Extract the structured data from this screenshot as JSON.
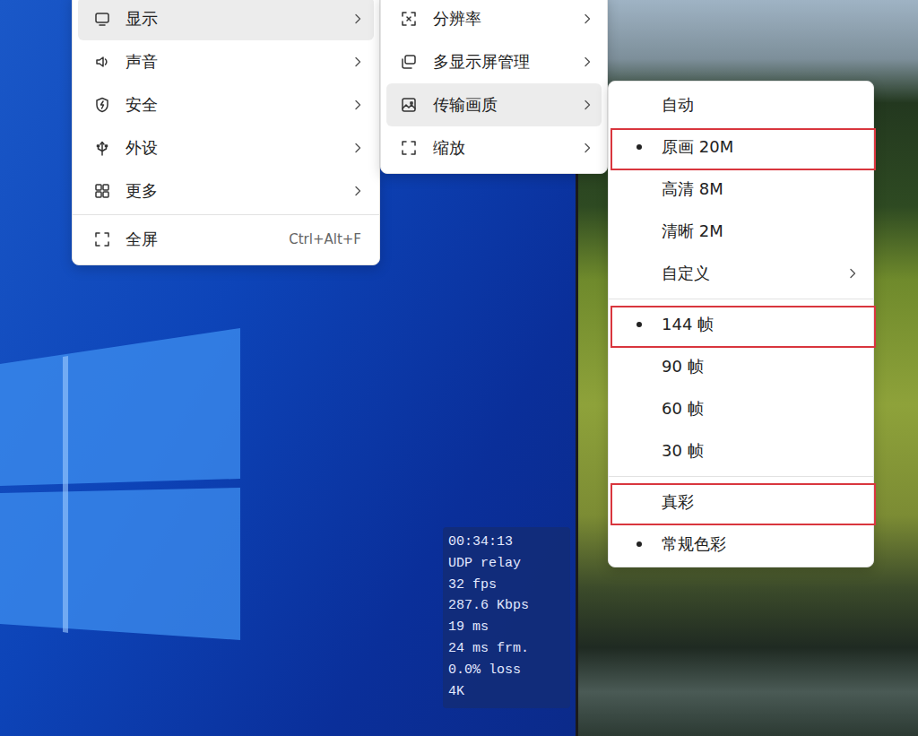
{
  "main_menu": {
    "items": [
      {
        "label": "显示",
        "has_submenu": true,
        "active": true
      },
      {
        "label": "声音",
        "has_submenu": true,
        "active": false
      },
      {
        "label": "安全",
        "has_submenu": true,
        "active": false
      },
      {
        "label": "外设",
        "has_submenu": true,
        "active": false
      },
      {
        "label": "更多",
        "has_submenu": true,
        "active": false
      }
    ],
    "footer_item": {
      "label": "全屏",
      "shortcut": "Ctrl+Alt+F"
    }
  },
  "display_menu": {
    "items": [
      {
        "label": "分辨率",
        "has_submenu": true,
        "active": false
      },
      {
        "label": "多显示屏管理",
        "has_submenu": true,
        "active": false
      },
      {
        "label": "传输画质",
        "has_submenu": true,
        "active": true
      },
      {
        "label": "缩放",
        "has_submenu": true,
        "active": false
      }
    ]
  },
  "quality_menu": {
    "groups": [
      {
        "items": [
          {
            "label": "自动",
            "selected": false,
            "has_submenu": false,
            "marked": false
          },
          {
            "label": "原画 20M",
            "selected": true,
            "has_submenu": false,
            "marked": true
          },
          {
            "label": "高清 8M",
            "selected": false,
            "has_submenu": false,
            "marked": false
          },
          {
            "label": "清晰 2M",
            "selected": false,
            "has_submenu": false,
            "marked": false
          },
          {
            "label": "自定义",
            "selected": false,
            "has_submenu": true,
            "marked": false
          }
        ]
      },
      {
        "items": [
          {
            "label": "144 帧",
            "selected": true,
            "has_submenu": false,
            "marked": true
          },
          {
            "label": "90 帧",
            "selected": false,
            "has_submenu": false,
            "marked": false
          },
          {
            "label": "60 帧",
            "selected": false,
            "has_submenu": false,
            "marked": false
          },
          {
            "label": "30 帧",
            "selected": false,
            "has_submenu": false,
            "marked": false
          }
        ]
      },
      {
        "items": [
          {
            "label": "真彩",
            "selected": false,
            "has_submenu": false,
            "marked": true
          },
          {
            "label": "常规色彩",
            "selected": true,
            "has_submenu": false,
            "marked": false
          }
        ]
      }
    ]
  },
  "stats": [
    "00:34:13",
    "UDP relay",
    "32 fps",
    "287.6 Kbps",
    "19 ms",
    "24 ms frm.",
    "0.0% loss",
    "4K"
  ]
}
